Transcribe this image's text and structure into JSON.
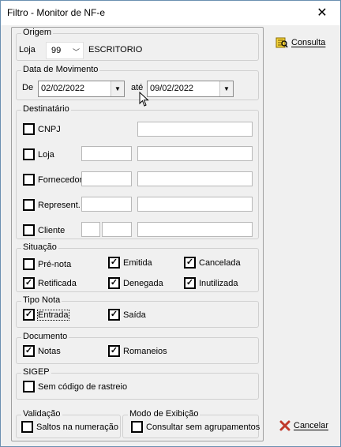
{
  "window": {
    "title": "Filtro - Monitor de NF-e",
    "close": "✕"
  },
  "origem": {
    "title": "Origem",
    "loja_label": "Loja",
    "loja_value": "99",
    "loja_name": "ESCRITORIO"
  },
  "data_movimento": {
    "title": "Data de Movimento",
    "de_label": "De",
    "de_value": "02/02/2022",
    "ate_label": "até",
    "ate_value": "09/02/2022"
  },
  "destinatario": {
    "title": "Destinatário",
    "rows": [
      {
        "label": "CNPJ"
      },
      {
        "label": "Loja"
      },
      {
        "label": "Fornecedor"
      },
      {
        "label": "Represent."
      },
      {
        "label": "Cliente"
      }
    ]
  },
  "situacao": {
    "title": "Situação",
    "items": [
      {
        "label": "Pré-nota",
        "checked": false
      },
      {
        "label": "Emitida",
        "checked": true
      },
      {
        "label": "Cancelada",
        "checked": true
      },
      {
        "label": "Retificada",
        "checked": true
      },
      {
        "label": "Denegada",
        "checked": true
      },
      {
        "label": "Inutilizada",
        "checked": true
      }
    ]
  },
  "tipo_nota": {
    "title": "Tipo Nota",
    "items": [
      {
        "label": "Entrada",
        "checked": true
      },
      {
        "label": "Saída",
        "checked": true
      }
    ]
  },
  "documento": {
    "title": "Documento",
    "items": [
      {
        "label": "Notas",
        "checked": true
      },
      {
        "label": "Romaneios",
        "checked": true
      }
    ]
  },
  "sigep": {
    "title": "SIGEP",
    "items": [
      {
        "label": "Sem código de rastreio",
        "checked": false
      }
    ]
  },
  "validacao": {
    "title": "Validação",
    "items": [
      {
        "label": "Saltos na numeração",
        "checked": false
      }
    ]
  },
  "modo_exibicao": {
    "title": "Modo de Exibição",
    "items": [
      {
        "label": "Consultar sem agrupamentos",
        "checked": false
      }
    ]
  },
  "actions": {
    "consulta": "Consulta",
    "cancelar": "Cancelar"
  },
  "check_glyph": "✓"
}
